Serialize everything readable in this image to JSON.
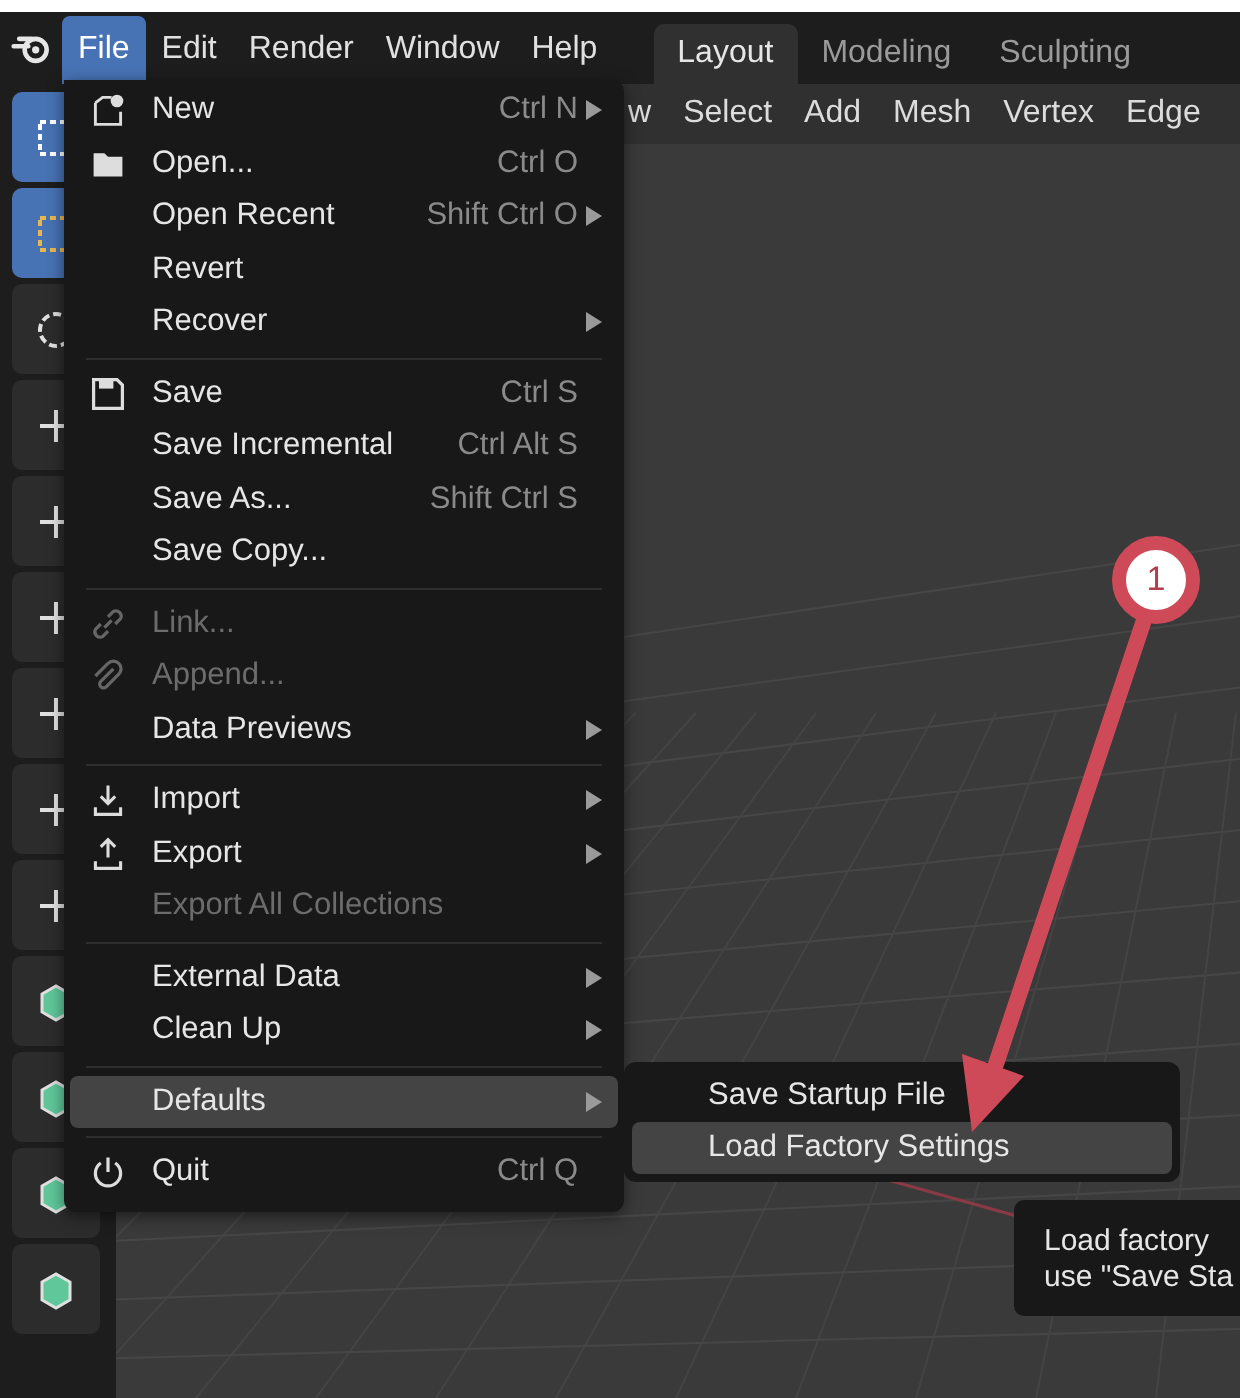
{
  "top_menu": [
    {
      "label": "File",
      "selected": true
    },
    {
      "label": "Edit",
      "selected": false
    },
    {
      "label": "Render",
      "selected": false
    },
    {
      "label": "Window",
      "selected": false
    },
    {
      "label": "Help",
      "selected": false
    }
  ],
  "workspace_tabs": [
    {
      "label": "Layout",
      "selected": true
    },
    {
      "label": "Modeling",
      "selected": false
    },
    {
      "label": "Sculpting",
      "selected": false
    }
  ],
  "viewport_header": [
    "w",
    "Select",
    "Add",
    "Mesh",
    "Vertex",
    "Edge"
  ],
  "file_menu": [
    [
      {
        "label": "New",
        "shortcut": "Ctrl N",
        "submenu": true,
        "disabled": false,
        "highlighted": false
      },
      {
        "label": "Open...",
        "shortcut": "Ctrl O",
        "submenu": false,
        "disabled": false,
        "highlighted": false
      },
      {
        "label": "Open Recent",
        "shortcut": "Shift Ctrl O",
        "submenu": true,
        "disabled": false,
        "highlighted": false
      },
      {
        "label": "Revert",
        "submenu": false,
        "disabled": false,
        "highlighted": false
      },
      {
        "label": "Recover",
        "submenu": true,
        "disabled": false,
        "highlighted": false
      }
    ],
    [
      {
        "label": "Save",
        "shortcut": "Ctrl S",
        "submenu": false,
        "disabled": false,
        "highlighted": false
      },
      {
        "label": "Save Incremental",
        "shortcut": "Ctrl Alt S",
        "submenu": false,
        "disabled": false,
        "highlighted": false
      },
      {
        "label": "Save As...",
        "shortcut": "Shift Ctrl S",
        "submenu": false,
        "disabled": false,
        "highlighted": false
      },
      {
        "label": "Save Copy...",
        "submenu": false,
        "disabled": false,
        "highlighted": false
      }
    ],
    [
      {
        "label": "Link...",
        "submenu": false,
        "disabled": true,
        "highlighted": false
      },
      {
        "label": "Append...",
        "submenu": false,
        "disabled": true,
        "highlighted": false
      },
      {
        "label": "Data Previews",
        "submenu": true,
        "disabled": false,
        "highlighted": false
      }
    ],
    [
      {
        "label": "Import",
        "submenu": true,
        "disabled": false,
        "highlighted": false
      },
      {
        "label": "Export",
        "submenu": true,
        "disabled": false,
        "highlighted": false
      },
      {
        "label": "Export All Collections",
        "submenu": false,
        "disabled": true,
        "highlighted": false
      }
    ],
    [
      {
        "label": "External Data",
        "submenu": true,
        "disabled": false,
        "highlighted": false
      },
      {
        "label": "Clean Up",
        "submenu": true,
        "disabled": false,
        "highlighted": false
      }
    ],
    [
      {
        "label": "Defaults",
        "submenu": true,
        "disabled": false,
        "highlighted": true
      }
    ],
    [
      {
        "label": "Quit",
        "shortcut": "Ctrl Q",
        "submenu": false,
        "disabled": false,
        "highlighted": false
      }
    ]
  ],
  "defaults_submenu": [
    {
      "label": "Save Startup File",
      "highlighted": false
    },
    {
      "label": "Load Factory Settings",
      "highlighted": true
    }
  ],
  "tooltip": [
    "Load factory",
    "use \"Save Sta"
  ],
  "annotation": {
    "number": "1"
  }
}
